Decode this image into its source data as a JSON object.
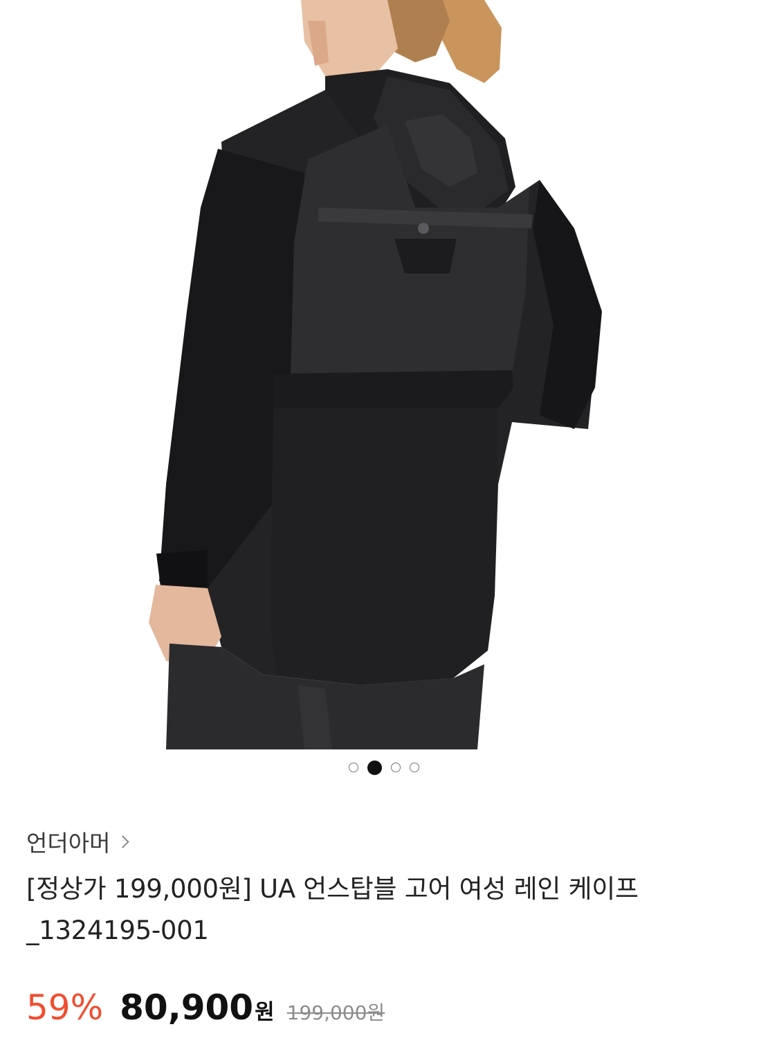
{
  "product": {
    "brand": "언더아머",
    "title": "[정상가 199,000원] UA 언스탑블 고어 여성 레인 케이프_1324195-001",
    "discount_rate": "59%",
    "sale_price": "80,900",
    "currency": "원",
    "original_price": "199,000원"
  },
  "carousel": {
    "total": 4,
    "active_index": 1
  }
}
